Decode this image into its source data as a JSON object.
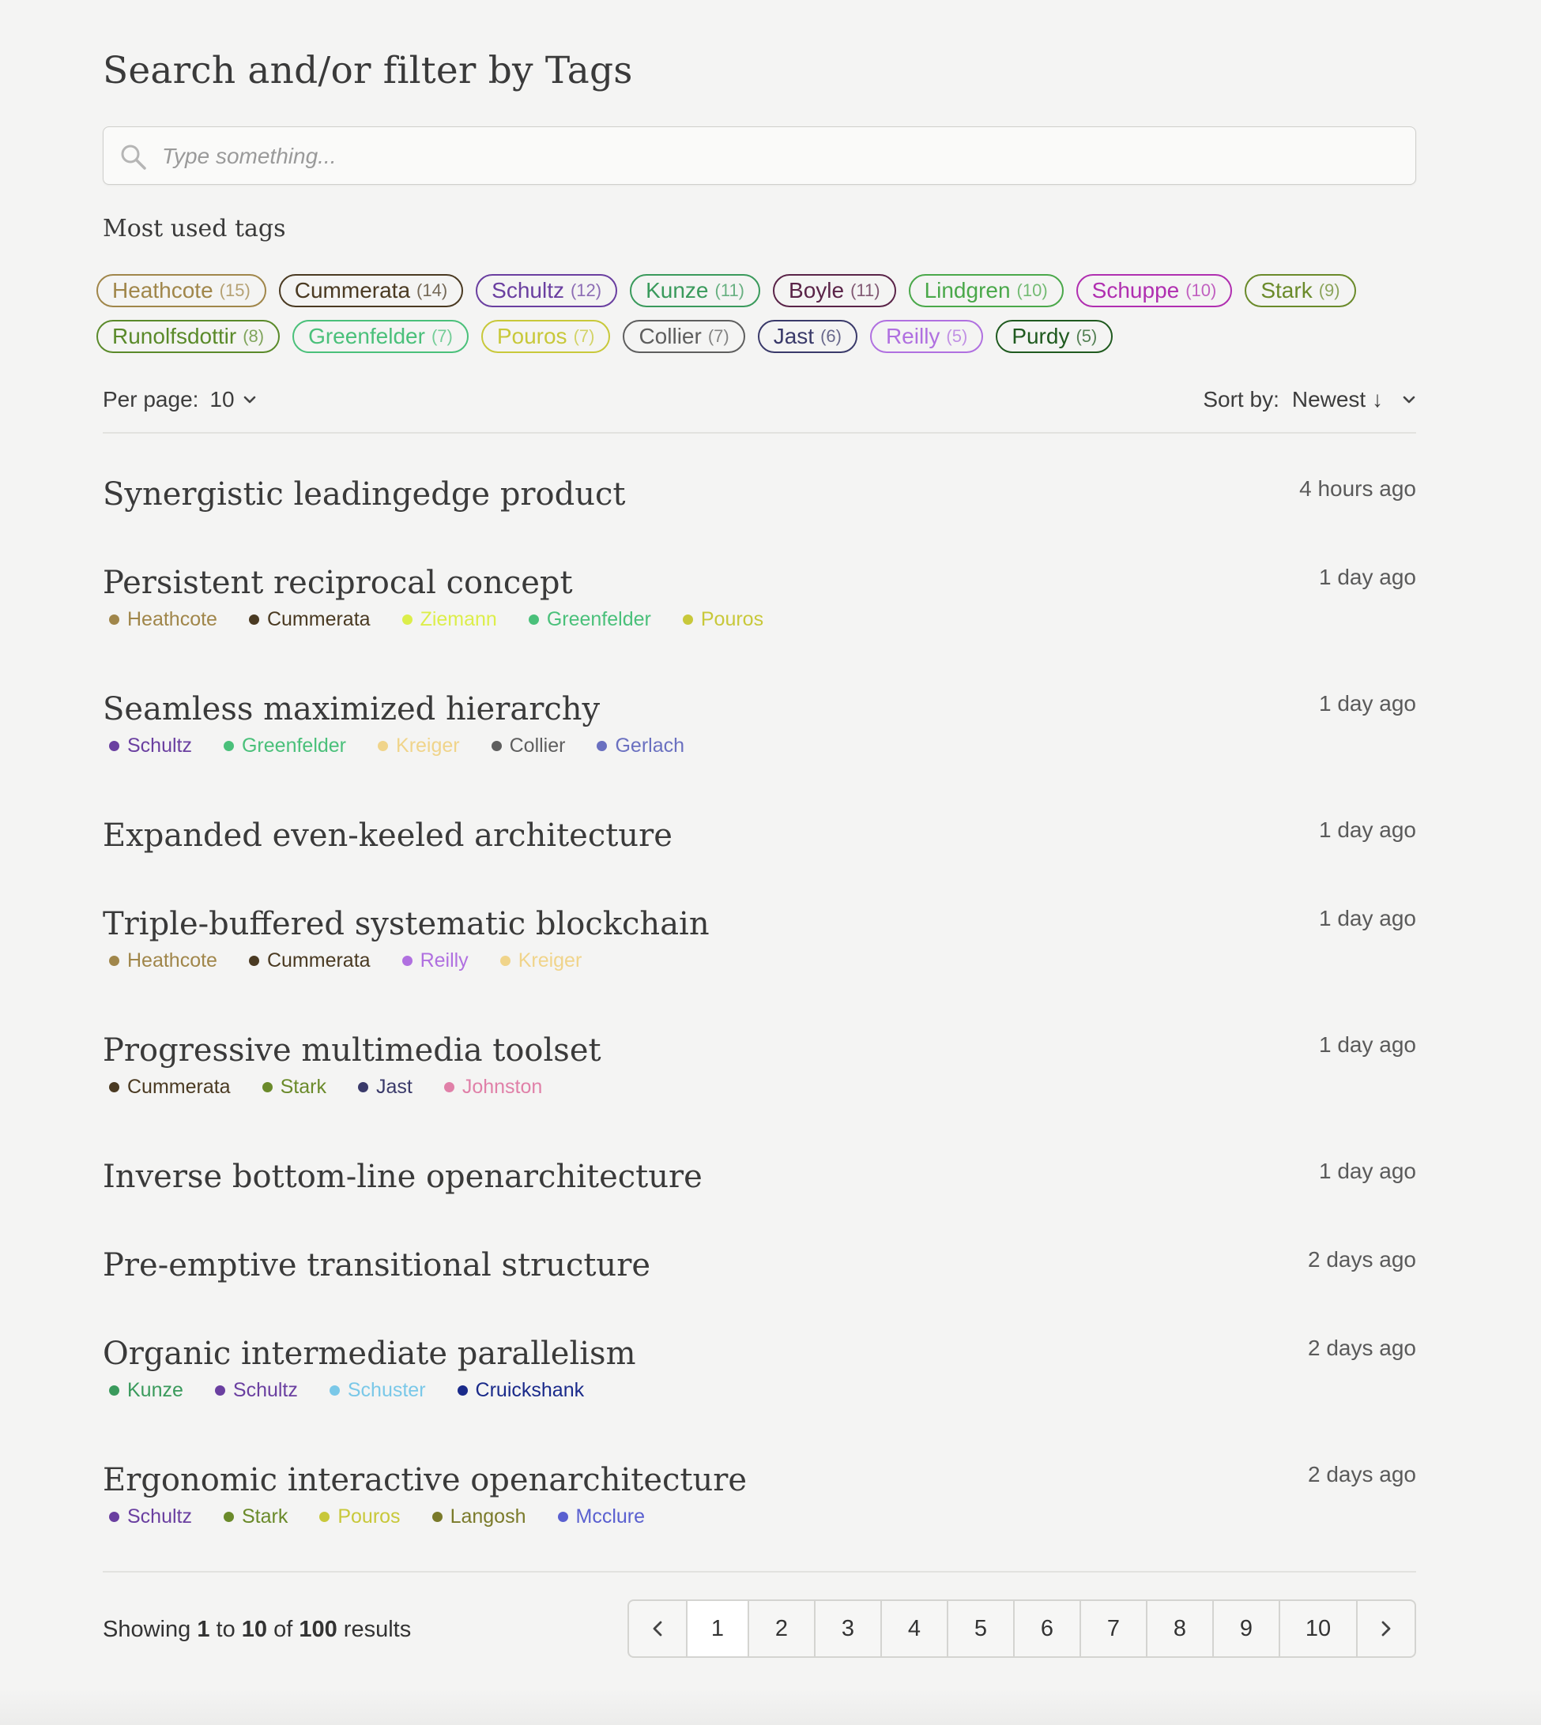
{
  "header": {
    "title": "Search and/or filter by Tags"
  },
  "search": {
    "placeholder": "Type something..."
  },
  "most_used": {
    "label": "Most used tags",
    "tags": [
      {
        "name": "Heathcote",
        "count": "(15)",
        "color": "#a0864a"
      },
      {
        "name": "Cummerata",
        "count": "(14)",
        "color": "#4a3a22"
      },
      {
        "name": "Schultz",
        "count": "(12)",
        "color": "#6a3fa0"
      },
      {
        "name": "Kunze",
        "count": "(11)",
        "color": "#3a9a5c"
      },
      {
        "name": "Boyle",
        "count": "(11)",
        "color": "#5a2448"
      },
      {
        "name": "Lindgren",
        "count": "(10)",
        "color": "#4aa84a"
      },
      {
        "name": "Schuppe",
        "count": "(10)",
        "color": "#b02fb0"
      },
      {
        "name": "Stark",
        "count": "(9)",
        "color": "#6a8a2a"
      },
      {
        "name": "Runolfsdottir",
        "count": "(8)",
        "color": "#5a8a2a"
      },
      {
        "name": "Greenfelder",
        "count": "(7)",
        "color": "#4ac07a"
      },
      {
        "name": "Pouros",
        "count": "(7)",
        "color": "#c8c83a"
      },
      {
        "name": "Collier",
        "count": "(7)",
        "color": "#5e5e5e"
      },
      {
        "name": "Jast",
        "count": "(6)",
        "color": "#3a3a6a"
      },
      {
        "name": "Reilly",
        "count": "(5)",
        "color": "#b070e0"
      },
      {
        "name": "Purdy",
        "count": "(5)",
        "color": "#1f5a1f"
      }
    ]
  },
  "controls": {
    "per_page_label": "Per page:",
    "per_page_value": "10",
    "sort_label": "Sort by:",
    "sort_value": "Newest ↓"
  },
  "items": [
    {
      "title": "Synergistic leadingedge product",
      "time": "4 hours ago",
      "tags": []
    },
    {
      "title": "Persistent reciprocal concept",
      "time": "1 day ago",
      "tags": [
        {
          "name": "Heathcote",
          "color": "#a0864a"
        },
        {
          "name": "Cummerata",
          "color": "#4a3a22"
        },
        {
          "name": "Ziemann",
          "color": "#dcee4a"
        },
        {
          "name": "Greenfelder",
          "color": "#4ac07a"
        },
        {
          "name": "Pouros",
          "color": "#c8c83a"
        }
      ]
    },
    {
      "title": "Seamless maximized hierarchy",
      "time": "1 day ago",
      "tags": [
        {
          "name": "Schultz",
          "color": "#6a3fa0"
        },
        {
          "name": "Greenfelder",
          "color": "#4ac07a"
        },
        {
          "name": "Kreiger",
          "color": "#f0d48a"
        },
        {
          "name": "Collier",
          "color": "#5e5e5e"
        },
        {
          "name": "Gerlach",
          "color": "#6a70c0"
        }
      ]
    },
    {
      "title": "Expanded even-keeled architecture",
      "time": "1 day ago",
      "tags": []
    },
    {
      "title": "Triple-buffered systematic blockchain",
      "time": "1 day ago",
      "tags": [
        {
          "name": "Heathcote",
          "color": "#a0864a"
        },
        {
          "name": "Cummerata",
          "color": "#4a3a22"
        },
        {
          "name": "Reilly",
          "color": "#b070e0"
        },
        {
          "name": "Kreiger",
          "color": "#f0d48a"
        }
      ]
    },
    {
      "title": "Progressive multimedia toolset",
      "time": "1 day ago",
      "tags": [
        {
          "name": "Cummerata",
          "color": "#4a3a22"
        },
        {
          "name": "Stark",
          "color": "#6a8a2a"
        },
        {
          "name": "Jast",
          "color": "#3a3a6a"
        },
        {
          "name": "Johnston",
          "color": "#e080a8"
        }
      ]
    },
    {
      "title": "Inverse bottom-line openarchitecture",
      "time": "1 day ago",
      "tags": []
    },
    {
      "title": "Pre-emptive transitional structure",
      "time": "2 days ago",
      "tags": []
    },
    {
      "title": "Organic intermediate parallelism",
      "time": "2 days ago",
      "tags": [
        {
          "name": "Kunze",
          "color": "#3a9a5c"
        },
        {
          "name": "Schultz",
          "color": "#6a3fa0"
        },
        {
          "name": "Schuster",
          "color": "#7ac8e8"
        },
        {
          "name": "Cruickshank",
          "color": "#1a2a8a"
        }
      ]
    },
    {
      "title": "Ergonomic interactive openarchitecture",
      "time": "2 days ago",
      "tags": [
        {
          "name": "Schultz",
          "color": "#6a3fa0"
        },
        {
          "name": "Stark",
          "color": "#6a8a2a"
        },
        {
          "name": "Pouros",
          "color": "#c8c83a"
        },
        {
          "name": "Langosh",
          "color": "#7a7a2a"
        },
        {
          "name": "Mcclure",
          "color": "#5a60d0"
        }
      ]
    }
  ],
  "footer": {
    "showing_prefix": "Showing",
    "from": "1",
    "to_word": "to",
    "to": "10",
    "of_word": "of",
    "total": "100",
    "results_word": "results"
  },
  "pagination": {
    "prev_icon": "chevron-left-icon",
    "next_icon": "chevron-right-icon",
    "pages": [
      "1",
      "2",
      "3",
      "4",
      "5",
      "6",
      "7",
      "8",
      "9",
      "10"
    ],
    "active": "1"
  }
}
